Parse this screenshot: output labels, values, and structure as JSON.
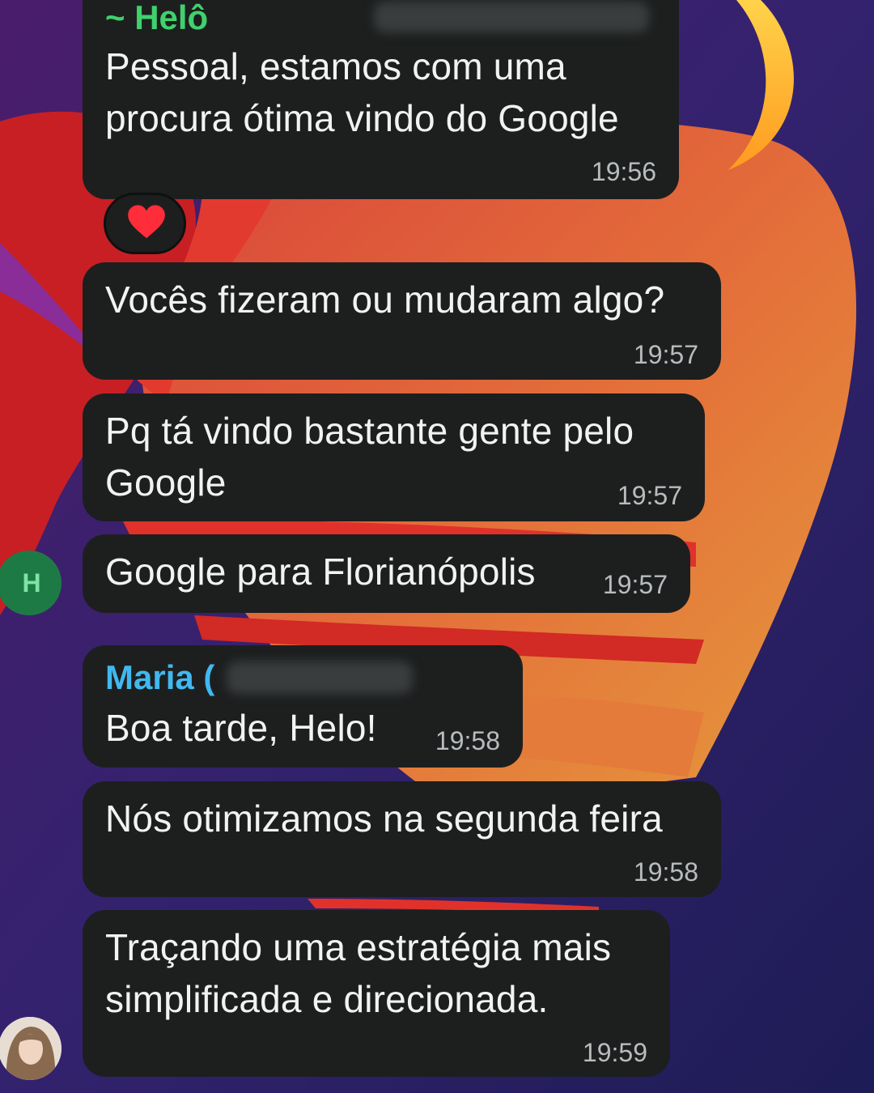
{
  "messages": [
    {
      "sender": "~ Helô",
      "sender_color": "#3fd16d",
      "lines": [
        "Pessoal, estamos com uma",
        "procura ótima vindo do Google"
      ],
      "time": "19:56",
      "reaction": "❤️"
    },
    {
      "lines": [
        "Vocês fizeram ou mudaram algo?"
      ],
      "time": "19:57"
    },
    {
      "lines": [
        "Pq tá vindo bastante gente pelo",
        "Google"
      ],
      "time": "19:57"
    },
    {
      "lines": [
        "Google para Florianópolis"
      ],
      "time": "19:57",
      "avatar_letter": "H",
      "avatar_color": "#1e7a45"
    },
    {
      "sender": "Maria (",
      "sender_color": "#41b8f0",
      "lines": [
        "Boa tarde, Helo!"
      ],
      "time": "19:58"
    },
    {
      "lines": [
        "Nós otimizamos na segunda feira"
      ],
      "time": "19:58"
    },
    {
      "lines": [
        "Traçando uma estratégia mais",
        "simplificada e direcionada."
      ],
      "time": "19:59"
    }
  ]
}
